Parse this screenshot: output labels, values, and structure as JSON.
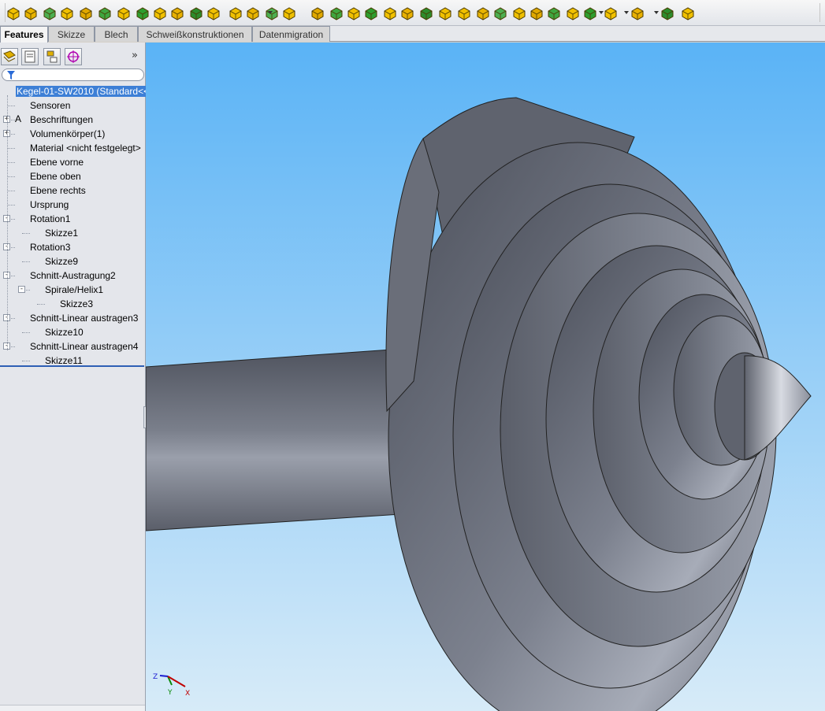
{
  "command_manager": {
    "tabs": [
      {
        "label": "Features",
        "active": true
      },
      {
        "label": "Skizze",
        "active": false
      },
      {
        "label": "Blech",
        "active": false
      },
      {
        "label": "Schweißkonstruktionen",
        "active": false
      },
      {
        "label": "Datenmigration",
        "active": false
      }
    ]
  },
  "feature_tree": {
    "root": "Kegel-01-SW2010  (Standard<<",
    "items": [
      {
        "label": "Sensoren",
        "icon": "sensor-icon"
      },
      {
        "label": "Beschriftungen",
        "icon": "annotation-icon"
      },
      {
        "label": "Volumenkörper(1)",
        "icon": "solid-bodies-icon"
      },
      {
        "label": "Material <nicht festgelegt>",
        "icon": "material-icon"
      },
      {
        "label": "Ebene vorne",
        "icon": "plane-icon"
      },
      {
        "label": "Ebene oben",
        "icon": "plane-icon"
      },
      {
        "label": "Ebene rechts",
        "icon": "plane-icon"
      },
      {
        "label": "Ursprung",
        "icon": "origin-icon"
      },
      {
        "label": "Rotation1",
        "icon": "revolve-icon"
      },
      {
        "label": "Skizze1",
        "icon": "sketch-icon"
      },
      {
        "label": "Rotation3",
        "icon": "revolve-icon"
      },
      {
        "label": "Skizze9",
        "icon": "sketch-icon"
      },
      {
        "label": "Schnitt-Austragung2",
        "icon": "swept-cut-icon"
      },
      {
        "label": "Spirale/Helix1",
        "icon": "helix-icon"
      },
      {
        "label": "Skizze3",
        "icon": "sketch-icon"
      },
      {
        "label": "Schnitt-Linear austragen3",
        "icon": "extruded-cut-icon"
      },
      {
        "label": "Skizze10",
        "icon": "sketch-icon"
      },
      {
        "label": "Schnitt-Linear austragen4",
        "icon": "extruded-cut-icon"
      },
      {
        "label": "Skizze11",
        "icon": "sketch-icon"
      }
    ]
  },
  "triad": {
    "z": "Z",
    "y": "Y",
    "x": "X"
  },
  "colors": {
    "viewport_top": "#5ab3f6",
    "viewport_bottom": "#d7ebf8",
    "model_gray": "#6d7280",
    "selection": "#3d7fd6"
  }
}
